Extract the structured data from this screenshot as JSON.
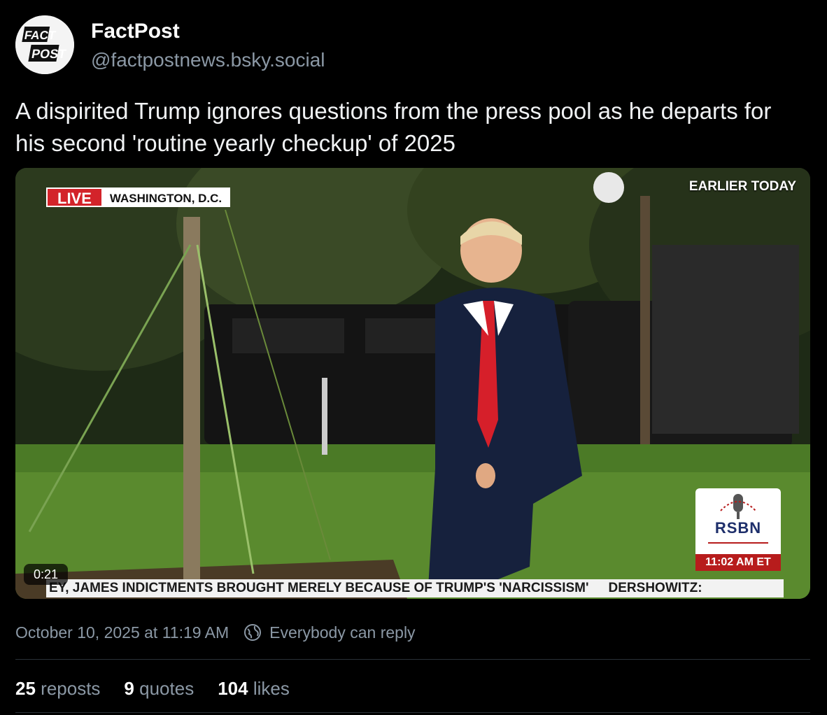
{
  "author": {
    "display_name": "FactPost",
    "handle": "@factpostnews.bsky.social",
    "avatar_text_line1": "FACT",
    "avatar_text_line2": "POST"
  },
  "post": {
    "text": "A dispirited Trump ignores questions from the press pool as he departs for his second 'routine yearly checkup' of 2025",
    "timestamp": "October 10, 2025 at 11:19 AM",
    "reply_setting": "Everybody can reply"
  },
  "video": {
    "live_label": "LIVE",
    "location": "WASHINGTON, D.C.",
    "earlier_label": "EARLIER TODAY",
    "network": "RSBN",
    "network_time": "11:02 AM ET",
    "ticker_text": "EY, JAMES INDICTMENTS BROUGHT MERELY BECAUSE OF TRUMP'S 'NARCISSISM'",
    "ticker_text_2": "DERSHOWITZ:",
    "duration": "0:21"
  },
  "stats": {
    "reposts_count": "25",
    "reposts_label": "reposts",
    "quotes_count": "9",
    "quotes_label": "quotes",
    "likes_count": "104",
    "likes_label": "likes"
  },
  "colors": {
    "background": "#000000",
    "muted_text": "#8b98a5",
    "live_red": "#d3232a",
    "rsbn_navy": "#1e2f6b"
  }
}
